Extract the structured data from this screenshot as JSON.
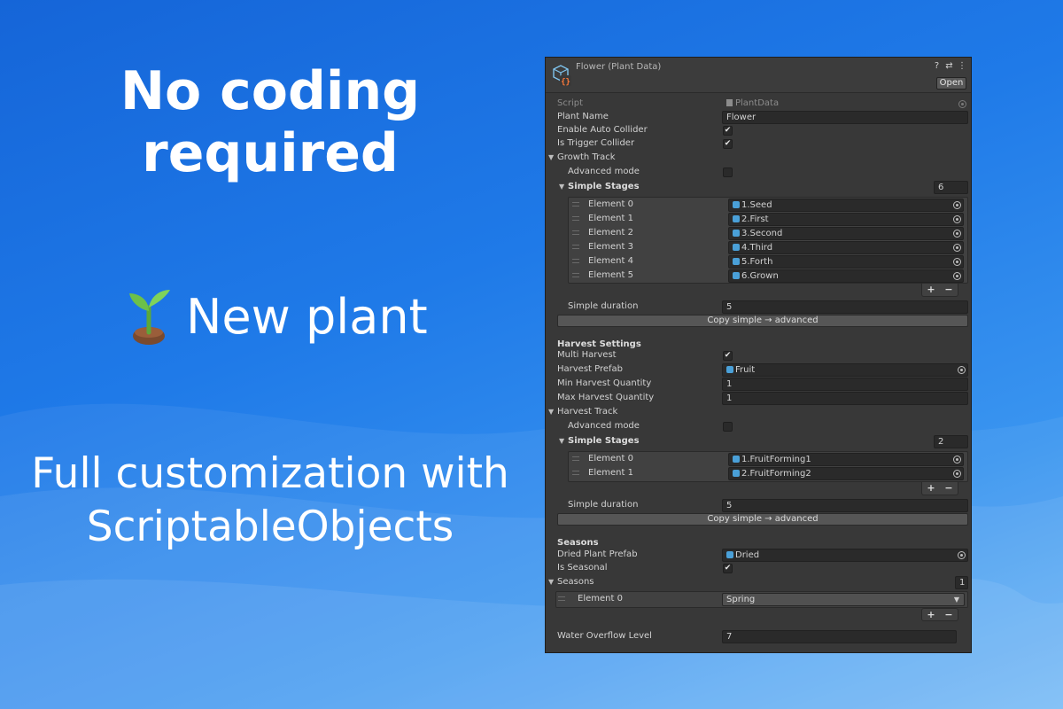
{
  "left_panel": {
    "headline_line1": "No coding",
    "headline_line2": "required",
    "new_plant_label": "New plant",
    "new_plant_icon": "sprout-icon",
    "tagline_line1": "Full customization with",
    "tagline_line2": "ScriptableObjects"
  },
  "inspector": {
    "title": "Flower (Plant Data)",
    "open_label": "Open",
    "header_icons": [
      "help-icon",
      "presets-icon",
      "more-icon"
    ],
    "script_label": "Script",
    "script_value": "PlantData",
    "plant_name_label": "Plant Name",
    "plant_name_value": "Flower",
    "enable_auto_collider_label": "Enable Auto Collider",
    "enable_auto_collider": true,
    "is_trigger_collider_label": "Is Trigger Collider",
    "is_trigger_collider": true,
    "growth_track": {
      "label": "Growth Track",
      "advanced_mode_label": "Advanced mode",
      "advanced_mode": false,
      "simple_stages_label": "Simple Stages",
      "simple_stages_count": "6",
      "elements": [
        {
          "label": "Element 0",
          "value": "1.Seed"
        },
        {
          "label": "Element 1",
          "value": "2.First"
        },
        {
          "label": "Element 2",
          "value": "3.Second"
        },
        {
          "label": "Element 3",
          "value": "4.Third"
        },
        {
          "label": "Element 4",
          "value": "5.Forth"
        },
        {
          "label": "Element 5",
          "value": "6.Grown"
        }
      ],
      "simple_duration_label": "Simple duration",
      "simple_duration_value": "5",
      "copy_button_label": "Copy simple → advanced"
    },
    "harvest_settings": {
      "header": "Harvest Settings",
      "multi_harvest_label": "Multi Harvest",
      "multi_harvest": true,
      "harvest_prefab_label": "Harvest Prefab",
      "harvest_prefab_value": "Fruit",
      "min_quantity_label": "Min Harvest Quantity",
      "min_quantity_value": "1",
      "max_quantity_label": "Max Harvest Quantity",
      "max_quantity_value": "1"
    },
    "harvest_track": {
      "label": "Harvest Track",
      "advanced_mode_label": "Advanced mode",
      "advanced_mode": false,
      "simple_stages_label": "Simple Stages",
      "simple_stages_count": "2",
      "elements": [
        {
          "label": "Element 0",
          "value": "1.FruitForming1"
        },
        {
          "label": "Element 1",
          "value": "2.FruitForming2"
        }
      ],
      "simple_duration_label": "Simple duration",
      "simple_duration_value": "5",
      "copy_button_label": "Copy simple → advanced"
    },
    "seasons_section": {
      "header": "Seasons",
      "dried_prefab_label": "Dried Plant Prefab",
      "dried_prefab_value": "Dried",
      "is_seasonal_label": "Is Seasonal",
      "is_seasonal": true,
      "seasons_label": "Seasons",
      "seasons_count": "1",
      "element_label": "Element 0",
      "element_value": "Spring"
    },
    "water_overflow_label": "Water Overflow Level",
    "water_overflow_value": "7"
  },
  "colors": {
    "background_top": "#1565d8",
    "background_bottom": "#6ab4f6",
    "panel_bg": "#383838",
    "field_bg": "#2a2a2a",
    "object_icon": "#4aa0d8"
  }
}
